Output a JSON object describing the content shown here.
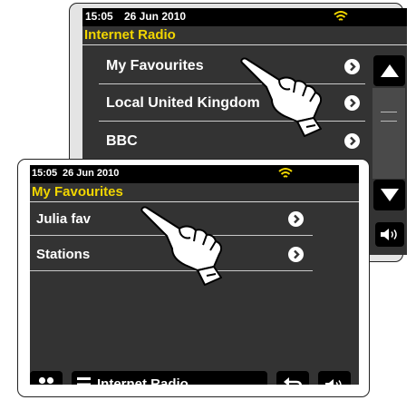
{
  "back_screen": {
    "status": {
      "time": "15:05",
      "date": "26 Jun 2010"
    },
    "title": "Internet Radio",
    "items": [
      {
        "label": "My Favourites"
      },
      {
        "label": "Local United Kingdom"
      },
      {
        "label": "BBC"
      }
    ],
    "icons": {
      "wifi": "wifi-icon",
      "scroll_up": "triangle-up-icon",
      "scroll_down": "triangle-down-icon",
      "volume": "speaker-icon",
      "pointer": "pointing-hand-icon"
    }
  },
  "front_screen": {
    "status": {
      "time": "15:05",
      "date": "26 Jun 2010"
    },
    "title": "My Favourites",
    "items": [
      {
        "label": "Julia fav"
      },
      {
        "label": "Stations"
      }
    ],
    "footer": {
      "mode_label": "Internet Radio"
    },
    "icons": {
      "wifi": "wifi-icon",
      "home": "four-dots-icon",
      "menu": "hamburger-menu-icon",
      "back": "return-arrow-icon",
      "volume": "speaker-icon",
      "pointer": "pointing-hand-icon"
    }
  },
  "colors": {
    "title": "#f2d600",
    "screen_bg": "#333333",
    "status_bg": "#000000",
    "wifi": "#f2d600"
  }
}
